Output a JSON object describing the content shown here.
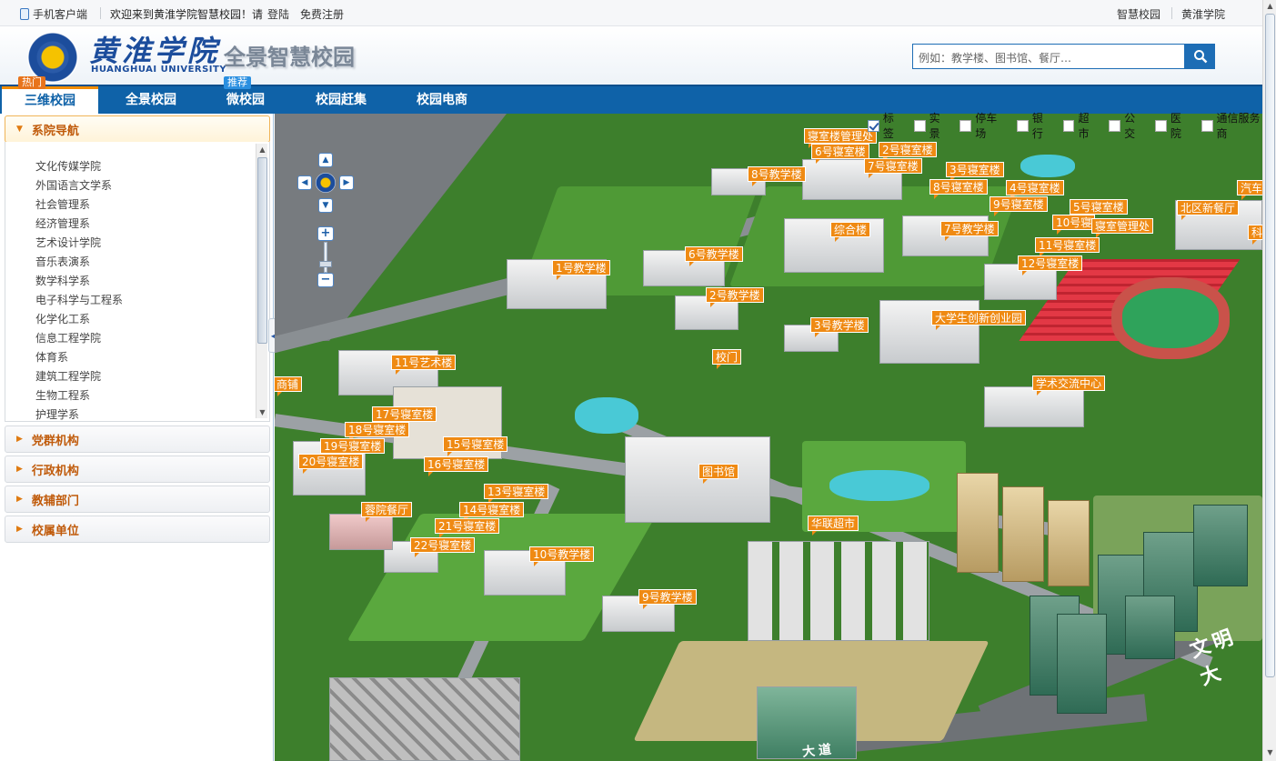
{
  "topbar": {
    "mobile_client": "手机客户端",
    "welcome": "欢迎来到黄淮学院智慧校园！请",
    "login": "登陆",
    "register": "免费注册",
    "right_links": [
      "智慧校园",
      "黄淮学院"
    ]
  },
  "header": {
    "logo_cn": "黄淮学院",
    "logo_en": "HUANGHUAI UNIVERSITY",
    "site_title": "全景智慧校园",
    "search_placeholder": "例如：教学楼、图书馆、餐厅…"
  },
  "nav": {
    "tabs": [
      "三维校园",
      "全景校园",
      "微校园",
      "校园赶集",
      "校园电商"
    ],
    "active_index": 0,
    "badges": {
      "hot": "热门",
      "recommend": "推荐"
    }
  },
  "sidebar": {
    "sections": [
      "系院导航",
      "党群机构",
      "行政机构",
      "教辅部门",
      "校属单位"
    ],
    "colleges": [
      "文化传媒学院",
      "外国语言文学系",
      "社会管理系",
      "经济管理系",
      "艺术设计学院",
      "音乐表演系",
      "数学科学系",
      "电子科学与工程系",
      "化学化工系",
      "信息工程学院",
      "体育系",
      "建筑工程学院",
      "生物工程系",
      "护理学系"
    ]
  },
  "map": {
    "layers": [
      {
        "label": "标签",
        "checked": true
      },
      {
        "label": "实景",
        "checked": false
      },
      {
        "label": "停车场",
        "checked": false
      },
      {
        "label": "银行",
        "checked": false
      },
      {
        "label": "超市",
        "checked": false
      },
      {
        "label": "公交",
        "checked": false
      },
      {
        "label": "医院",
        "checked": false
      },
      {
        "label": "通信服务商",
        "checked": false
      }
    ],
    "labels": [
      "寝室楼管理处",
      "6号寝室楼",
      "2号寝室楼",
      "7号寝室楼",
      "3号寝室楼",
      "8号教学楼",
      "8号寝室楼",
      "4号寝室楼",
      "9号寝室楼",
      "5号寝室楼",
      "北区新餐厅",
      "汽车",
      "10号寝",
      "寝室管理处",
      "综合楼",
      "7号教学楼",
      "11号寝室楼",
      "科",
      "6号教学楼",
      "12号寝室楼",
      "1号教学楼",
      "2号教学楼",
      "大学生创新创业园",
      "3号教学楼",
      "校门",
      "11号艺术楼",
      "商铺",
      "学术交流中心",
      "17号寝室楼",
      "18号寝室楼",
      "19号寝室楼",
      "15号寝室楼",
      "20号寝室楼",
      "16号寝室楼",
      "图书馆",
      "13号寝室楼",
      "14号寝室楼",
      "蓉院餐厅",
      "21号寝室楼",
      "华联超市",
      "22号寝室楼",
      "10号教学楼",
      "9号教学楼"
    ],
    "road_name": "文明大",
    "road_name_bottom": "大道"
  }
}
